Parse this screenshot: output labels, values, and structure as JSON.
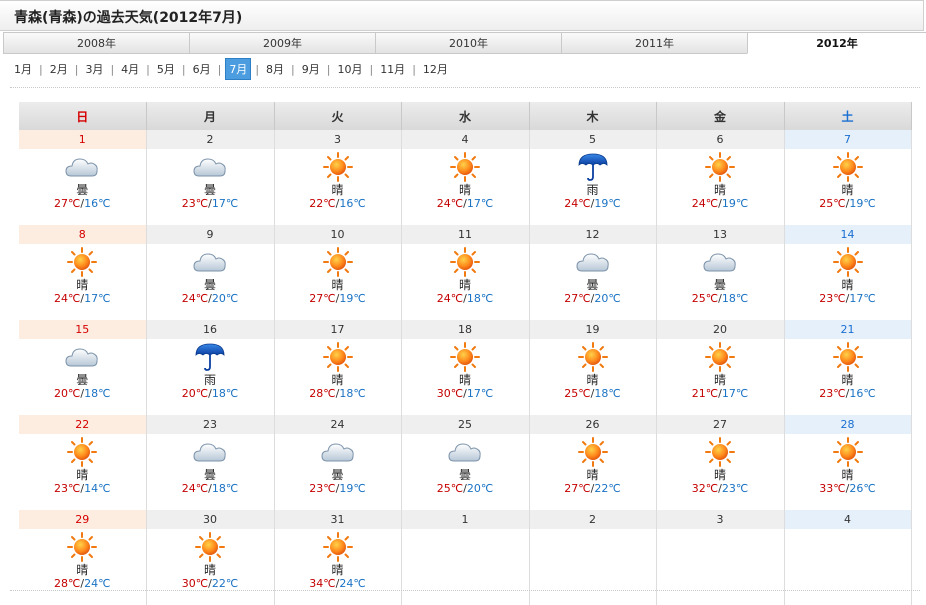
{
  "page_title": "青森(青森)の過去天気(2012年7月)",
  "year_tabs": [
    {
      "label": "2008年",
      "active": false
    },
    {
      "label": "2009年",
      "active": false
    },
    {
      "label": "2010年",
      "active": false
    },
    {
      "label": "2011年",
      "active": false
    },
    {
      "label": "2012年",
      "active": true
    }
  ],
  "months": [
    {
      "label": "1月"
    },
    {
      "label": "2月"
    },
    {
      "label": "3月"
    },
    {
      "label": "4月"
    },
    {
      "label": "5月"
    },
    {
      "label": "6月"
    },
    {
      "label": "7月"
    },
    {
      "label": "8月"
    },
    {
      "label": "9月"
    },
    {
      "label": "10月"
    },
    {
      "label": "11月"
    },
    {
      "label": "12月"
    }
  ],
  "active_month_index": 6,
  "weekdays": [
    "日",
    "月",
    "火",
    "水",
    "木",
    "金",
    "土"
  ],
  "colors": {
    "high_temp": "#c40000",
    "low_temp": "#1a73c4",
    "sunday": "#d50000",
    "saturday": "#1a6fd1",
    "active_month": "#4b9de0"
  },
  "weather_icons": {
    "曇": "cloud-icon",
    "晴": "sun-icon",
    "雨": "umbrella-icon"
  },
  "weeks": [
    [
      {
        "date": "1",
        "weather": "曇",
        "high": "27℃",
        "low": "16℃"
      },
      {
        "date": "2",
        "weather": "曇",
        "high": "23℃",
        "low": "17℃"
      },
      {
        "date": "3",
        "weather": "晴",
        "high": "22℃",
        "low": "16℃"
      },
      {
        "date": "4",
        "weather": "晴",
        "high": "24℃",
        "low": "17℃"
      },
      {
        "date": "5",
        "weather": "雨",
        "high": "24℃",
        "low": "19℃"
      },
      {
        "date": "6",
        "weather": "晴",
        "high": "24℃",
        "low": "19℃"
      },
      {
        "date": "7",
        "weather": "晴",
        "high": "25℃",
        "low": "19℃"
      }
    ],
    [
      {
        "date": "8",
        "weather": "晴",
        "high": "24℃",
        "low": "17℃"
      },
      {
        "date": "9",
        "weather": "曇",
        "high": "24℃",
        "low": "20℃"
      },
      {
        "date": "10",
        "weather": "晴",
        "high": "27℃",
        "low": "19℃"
      },
      {
        "date": "11",
        "weather": "晴",
        "high": "24℃",
        "low": "18℃"
      },
      {
        "date": "12",
        "weather": "曇",
        "high": "27℃",
        "low": "20℃"
      },
      {
        "date": "13",
        "weather": "曇",
        "high": "25℃",
        "low": "18℃"
      },
      {
        "date": "14",
        "weather": "晴",
        "high": "23℃",
        "low": "17℃"
      }
    ],
    [
      {
        "date": "15",
        "weather": "曇",
        "high": "20℃",
        "low": "18℃"
      },
      {
        "date": "16",
        "weather": "雨",
        "high": "20℃",
        "low": "18℃"
      },
      {
        "date": "17",
        "weather": "晴",
        "high": "28℃",
        "low": "18℃"
      },
      {
        "date": "18",
        "weather": "晴",
        "high": "30℃",
        "low": "17℃"
      },
      {
        "date": "19",
        "weather": "晴",
        "high": "25℃",
        "low": "18℃"
      },
      {
        "date": "20",
        "weather": "晴",
        "high": "21℃",
        "low": "17℃"
      },
      {
        "date": "21",
        "weather": "晴",
        "high": "23℃",
        "low": "16℃"
      }
    ],
    [
      {
        "date": "22",
        "weather": "晴",
        "high": "23℃",
        "low": "14℃"
      },
      {
        "date": "23",
        "weather": "曇",
        "high": "24℃",
        "low": "18℃"
      },
      {
        "date": "24",
        "weather": "曇",
        "high": "23℃",
        "low": "19℃"
      },
      {
        "date": "25",
        "weather": "曇",
        "high": "25℃",
        "low": "20℃"
      },
      {
        "date": "26",
        "weather": "晴",
        "high": "27℃",
        "low": "22℃"
      },
      {
        "date": "27",
        "weather": "晴",
        "high": "32℃",
        "low": "23℃"
      },
      {
        "date": "28",
        "weather": "晴",
        "high": "33℃",
        "low": "26℃"
      }
    ],
    [
      {
        "date": "29",
        "weather": "晴",
        "high": "28℃",
        "low": "24℃"
      },
      {
        "date": "30",
        "weather": "晴",
        "high": "30℃",
        "low": "22℃"
      },
      {
        "date": "31",
        "weather": "晴",
        "high": "34℃",
        "low": "24℃"
      },
      {
        "date": "1",
        "weather": "",
        "high": "",
        "low": ""
      },
      {
        "date": "2",
        "weather": "",
        "high": "",
        "low": ""
      },
      {
        "date": "3",
        "weather": "",
        "high": "",
        "low": ""
      },
      {
        "date": "4",
        "weather": "",
        "high": "",
        "low": ""
      }
    ]
  ]
}
